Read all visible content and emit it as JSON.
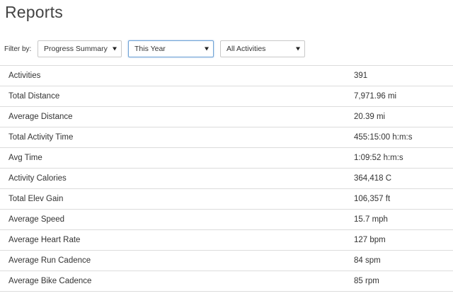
{
  "page": {
    "title": "Reports"
  },
  "filter": {
    "label": "Filter by:",
    "report_type": "Progress Summary",
    "period": "This Year",
    "activity": "All Activities"
  },
  "stats": [
    {
      "label": "Activities",
      "value": "391"
    },
    {
      "label": "Total Distance",
      "value": "7,971.96 mi"
    },
    {
      "label": "Average Distance",
      "value": "20.39 mi"
    },
    {
      "label": "Total Activity Time",
      "value": "455:15:00 h:m:s"
    },
    {
      "label": "Avg Time",
      "value": "1:09:52 h:m:s"
    },
    {
      "label": "Activity Calories",
      "value": "364,418 C"
    },
    {
      "label": "Total Elev Gain",
      "value": "106,357 ft"
    },
    {
      "label": "Average Speed",
      "value": "15.7 mph"
    },
    {
      "label": "Average Heart Rate",
      "value": "127 bpm"
    },
    {
      "label": "Average Run Cadence",
      "value": "84 spm"
    },
    {
      "label": "Average Bike Cadence",
      "value": "85 rpm"
    }
  ],
  "colors": {
    "focus_border": "#6fa3d6",
    "divider": "#dcdcdc",
    "text": "#333333"
  }
}
